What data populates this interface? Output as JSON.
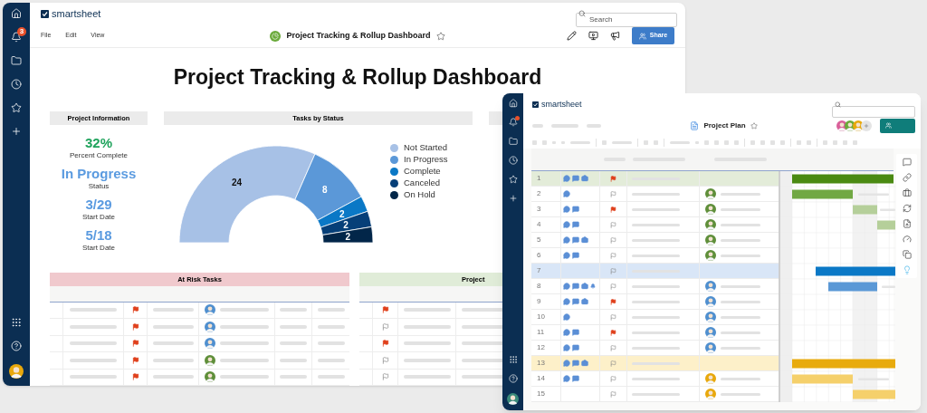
{
  "dashboard": {
    "sidebar": {
      "notification_count": "3"
    },
    "logo": "smartsheet",
    "search": {
      "placeholder": "Search"
    },
    "menu": [
      "File",
      "Edit",
      "View"
    ],
    "title": "Project Tracking & Rollup Dashboard",
    "share_button": "Share",
    "heading": "Project Tracking & Rollup Dashboard",
    "project_info": {
      "title": "Project Information",
      "metrics": [
        {
          "value": "32%",
          "label": "Percent Complete",
          "color": "#1fa35c"
        },
        {
          "value": "In Progress",
          "label": "Status",
          "color": "#5b9be0"
        },
        {
          "value": "3/29",
          "label": "Start Date",
          "color": "#5b9be0"
        },
        {
          "value": "5/18",
          "label": "Start Date",
          "color": "#5b9be0"
        }
      ]
    },
    "tasks_by_status": {
      "title": "Tasks by Status",
      "chart_data": {
        "type": "donut",
        "categories": [
          "Not Started",
          "In Progress",
          "Complete",
          "Canceled",
          "On Hold"
        ],
        "values": [
          24,
          8,
          2,
          2,
          2
        ],
        "colors": [
          "#a7c1e6",
          "#5b98d8",
          "#0a78c6",
          "#063f78",
          "#022649"
        ],
        "data_labels": true
      }
    },
    "at_risk_tasks": {
      "title": "At Risk Tasks",
      "rows": [
        {
          "flagged": true,
          "assignee": {
            "color": "#4f8fcf"
          }
        },
        {
          "flagged": true,
          "assignee": {
            "color": "#4f8fcf"
          }
        },
        {
          "flagged": true,
          "assignee": {
            "color": "#4f8fcf"
          }
        },
        {
          "flagged": true,
          "assignee": {
            "color": "#5f8f3a"
          }
        },
        {
          "flagged": true,
          "assignee": {
            "color": "#5f8f3a"
          }
        }
      ]
    },
    "project_table": {
      "title": "Project",
      "rows": [
        {
          "flagged": true
        },
        {
          "flagged": false
        },
        {
          "flagged": true
        },
        {
          "flagged": false
        },
        {
          "flagged": false
        }
      ]
    }
  },
  "plan": {
    "logo": "smartsheet",
    "title": "Project Plan",
    "rows": [
      {
        "number": "1",
        "kind": "parent",
        "color": "#e3ecd9",
        "icons": [
          {
            "kind": "comment"
          },
          {
            "kind": "chat"
          },
          {
            "kind": "attachment"
          }
        ],
        "flagged": true
      },
      {
        "number": "2",
        "kind": "task",
        "icons": [
          {
            "kind": "comment"
          }
        ],
        "flagged": false,
        "assignee": {
          "color": "#5f8f3a"
        }
      },
      {
        "number": "3",
        "kind": "task",
        "icons": [
          {
            "kind": "comment"
          },
          {
            "kind": "chat"
          }
        ],
        "flagged": true,
        "assignee": {
          "color": "#5f8f3a"
        }
      },
      {
        "number": "4",
        "kind": "task",
        "icons": [
          {
            "kind": "comment"
          },
          {
            "kind": "chat"
          }
        ],
        "flagged": false,
        "assignee": {
          "color": "#5f8f3a"
        }
      },
      {
        "number": "5",
        "kind": "task",
        "icons": [
          {
            "kind": "comment"
          },
          {
            "kind": "chat"
          },
          {
            "kind": "attachment"
          }
        ],
        "flagged": false,
        "assignee": {
          "color": "#5f8f3a"
        }
      },
      {
        "number": "6",
        "kind": "task",
        "icons": [
          {
            "kind": "comment"
          },
          {
            "kind": "chat"
          }
        ],
        "flagged": false,
        "assignee": {
          "color": "#5f8f3a"
        }
      },
      {
        "number": "7",
        "kind": "parent",
        "color": "#d9e6f7",
        "flagged": false
      },
      {
        "number": "8",
        "kind": "task",
        "icons": [
          {
            "kind": "comment"
          },
          {
            "kind": "chat"
          },
          {
            "kind": "attachment"
          },
          {
            "kind": "reminder"
          }
        ],
        "flagged": false,
        "assignee": {
          "color": "#4f8fcf"
        }
      },
      {
        "number": "9",
        "kind": "task",
        "icons": [
          {
            "kind": "comment"
          },
          {
            "kind": "chat"
          },
          {
            "kind": "attachment"
          }
        ],
        "flagged": true,
        "assignee": {
          "color": "#4f8fcf"
        }
      },
      {
        "number": "10",
        "kind": "task",
        "icons": [
          {
            "kind": "comment"
          }
        ],
        "flagged": false,
        "assignee": {
          "color": "#4f8fcf"
        }
      },
      {
        "number": "11",
        "kind": "task",
        "icons": [
          {
            "kind": "comment"
          },
          {
            "kind": "chat"
          }
        ],
        "flagged": true,
        "assignee": {
          "color": "#4f8fcf"
        }
      },
      {
        "number": "12",
        "kind": "task",
        "icons": [
          {
            "kind": "comment"
          },
          {
            "kind": "chat"
          }
        ],
        "flagged": false,
        "assignee": {
          "color": "#4f8fcf"
        }
      },
      {
        "number": "13",
        "kind": "parent",
        "color": "#fdf0c9",
        "icons": [
          {
            "kind": "comment"
          },
          {
            "kind": "chat"
          },
          {
            "kind": "attachment"
          }
        ],
        "flagged": false
      },
      {
        "number": "14",
        "kind": "task",
        "icons": [
          {
            "kind": "comment"
          },
          {
            "kind": "chat"
          }
        ],
        "flagged": false,
        "assignee": {
          "color": "#e8a80c"
        }
      },
      {
        "number": "15",
        "kind": "task",
        "flagged": false,
        "assignee": {
          "color": "#e8a80c"
        }
      }
    ]
  }
}
